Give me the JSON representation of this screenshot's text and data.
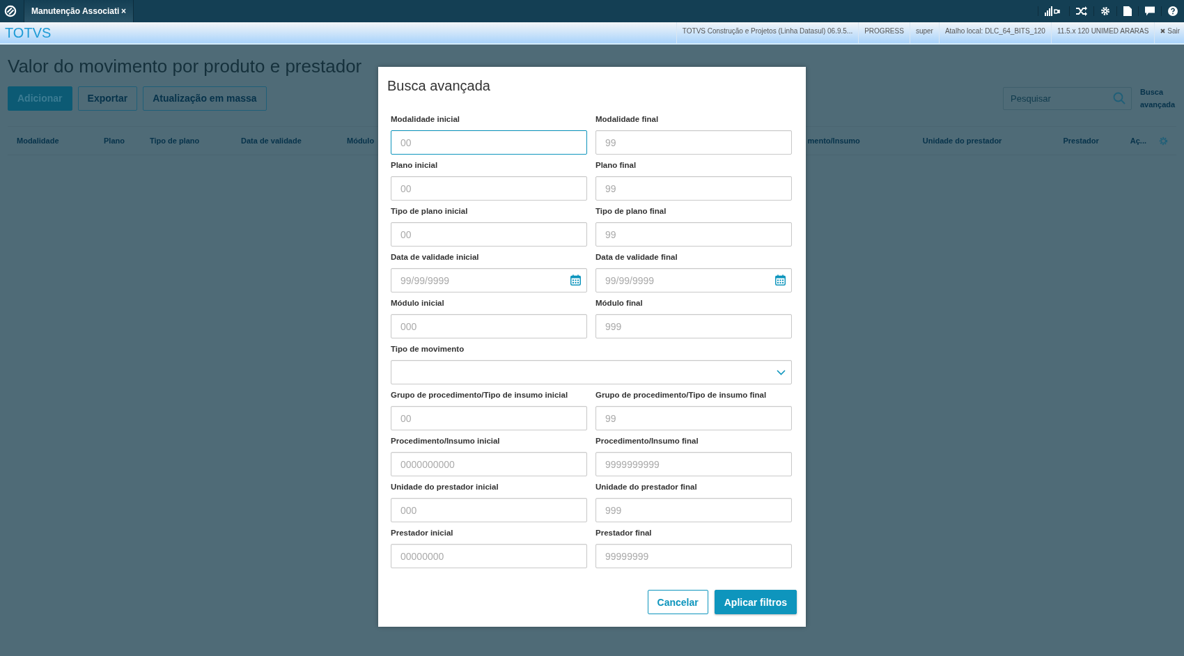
{
  "top_bar": {
    "tabs": [
      {
        "label": "Manutenção Associati",
        "close": "×",
        "selected": true
      }
    ]
  },
  "header": {
    "brand": "TOTVS",
    "info": [
      "TOTVS Construção e Projetos (Linha Datasul) 06.9.5...",
      "PROGRESS",
      "super",
      "Atalho local: DLC_64_BITS_120",
      "11.5.x 120 UNIMED ARARAS"
    ],
    "logout": "Sair"
  },
  "page": {
    "title": "Valor do movimento por produto e prestador",
    "actions": [
      {
        "label": "Adicionar",
        "kind": "primary"
      },
      {
        "label": "Exportar",
        "kind": "outline"
      },
      {
        "label": "Atualização em massa",
        "kind": "outline"
      }
    ],
    "search": {
      "placeholder": "Pesquisar"
    },
    "advanced_link": "Busca avançada",
    "columns_left": [
      "Modalidade",
      "Plano",
      "Tipo de plano",
      "Data de validade",
      "Módulo"
    ],
    "columns_right": [
      "mento/Insumo",
      "Unidade do prestador",
      "Prestador",
      "Aç..."
    ]
  },
  "dialog": {
    "title": "Busca avançada",
    "fields": [
      {
        "label": "Modalidade inicial",
        "placeholder": "00",
        "kind": "text",
        "focused": true
      },
      {
        "label": "Modalidade final",
        "placeholder": "99",
        "kind": "text",
        "focused": false
      },
      {
        "label": "Plano inicial",
        "placeholder": "00",
        "kind": "text",
        "focused": false
      },
      {
        "label": "Plano final",
        "placeholder": "99",
        "kind": "text",
        "focused": false
      },
      {
        "label": "Tipo de plano inicial",
        "placeholder": "00",
        "kind": "text",
        "focused": false
      },
      {
        "label": "Tipo de plano final",
        "placeholder": "99",
        "kind": "text",
        "focused": false
      },
      {
        "label": "Data de validade inicial",
        "placeholder": "99/99/9999",
        "kind": "date",
        "focused": false
      },
      {
        "label": "Data de validade final",
        "placeholder": "99/99/9999",
        "kind": "date",
        "focused": false
      },
      {
        "label": "Módulo inicial",
        "placeholder": "000",
        "kind": "text",
        "focused": false
      },
      {
        "label": "Módulo final",
        "placeholder": "999",
        "kind": "text",
        "focused": false
      },
      {
        "label": "Tipo de movimento",
        "kind": "select",
        "focused": false
      },
      {
        "label": "Grupo de procedimento/Tipo de insumo inicial",
        "placeholder": "00",
        "kind": "text",
        "focused": false
      },
      {
        "label": "Grupo de procedimento/Tipo de insumo final",
        "placeholder": "99",
        "kind": "text",
        "focused": false
      },
      {
        "label": "Procedimento/Insumo inicial",
        "placeholder": "0000000000",
        "kind": "text",
        "focused": false
      },
      {
        "label": "Procedimento/Insumo final",
        "placeholder": "9999999999",
        "kind": "text",
        "focused": false
      },
      {
        "label": "Unidade do prestador inicial",
        "placeholder": "000",
        "kind": "text",
        "focused": false
      },
      {
        "label": "Unidade do prestador final",
        "placeholder": "999",
        "kind": "text",
        "focused": false
      },
      {
        "label": "Prestador inicial",
        "placeholder": "00000000",
        "kind": "text",
        "focused": false
      },
      {
        "label": "Prestador final",
        "placeholder": "99999999",
        "kind": "text",
        "focused": false
      }
    ],
    "buttons": [
      {
        "label": "Cancelar",
        "kind": "outline"
      },
      {
        "label": "Aplicar filtros",
        "kind": "primary"
      }
    ]
  }
}
